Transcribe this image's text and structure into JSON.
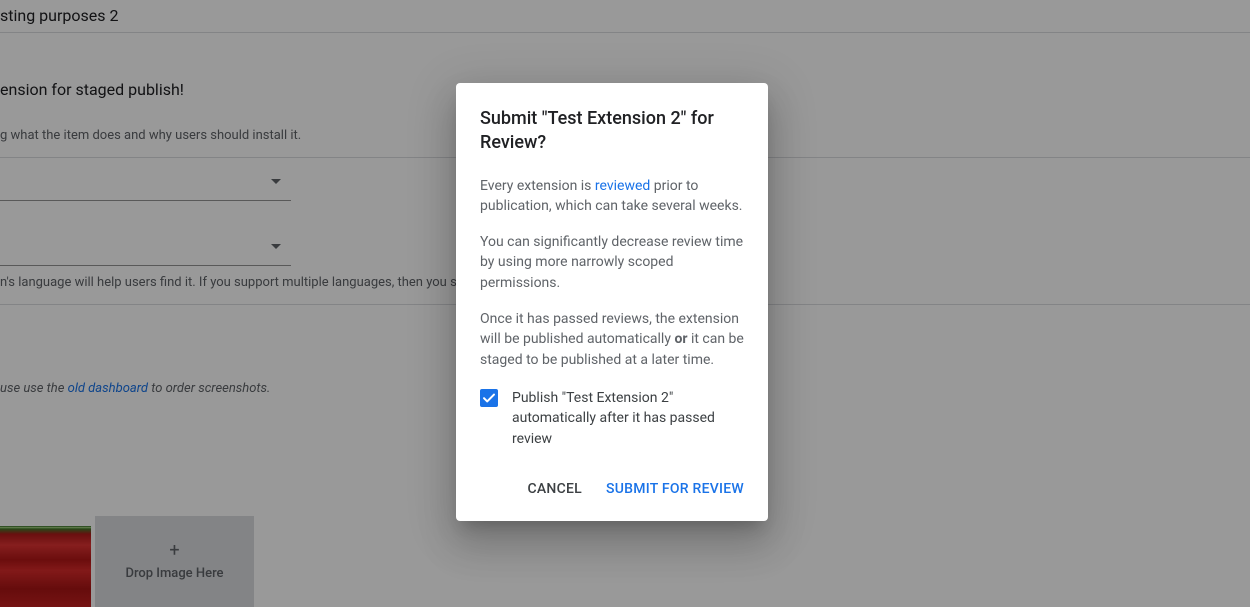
{
  "bg": {
    "title_fragment": "sting purposes 2",
    "stage_heading": "ension for staged publish!",
    "desc_hint": "g what the item does and why users should install it.",
    "lang_hint_pre": "n's language will help users find it. If you support multiple languages, then you sh",
    "screenshot_hint_pre": "use use the ",
    "old_dashboard_link": "old dashboard",
    "screenshot_hint_post": " to order screenshots.",
    "drop_label": "Drop Image Here"
  },
  "dialog": {
    "title": "Submit \"Test Extension 2\" for Review?",
    "p1_pre": "Every extension is ",
    "p1_link": "reviewed",
    "p1_post": " prior to publication, which can take several weeks.",
    "p2": "You can significantly decrease review time by using more narrowly scoped permissions.",
    "p3_pre": "Once it has passed reviews, the extension will be published automatically ",
    "p3_or": "or",
    "p3_post": " it can be staged to be published at a later time.",
    "checkbox_label": "Publish \"Test Extension 2\" automatically after it has passed review",
    "checkbox_checked": true,
    "cancel": "CANCEL",
    "submit": "SUBMIT FOR REVIEW"
  }
}
